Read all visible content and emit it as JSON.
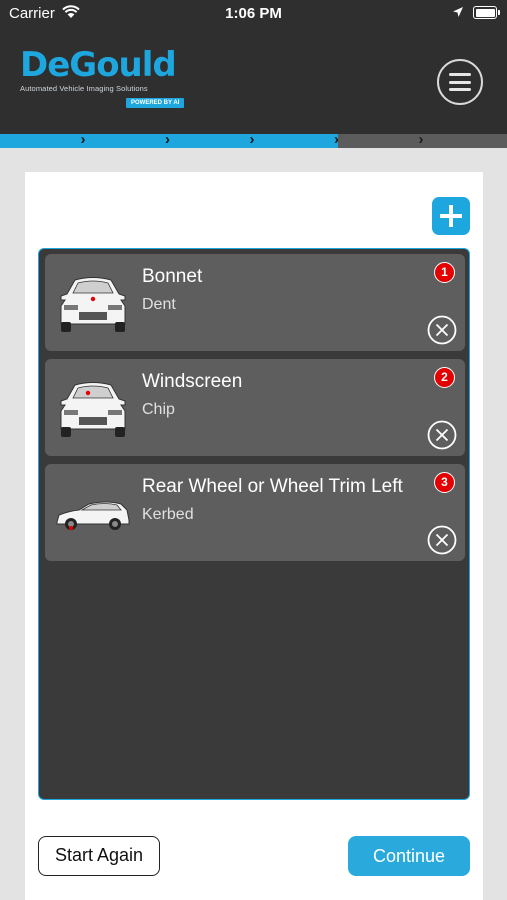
{
  "status_bar": {
    "carrier": "Carrier",
    "time": "1:06 PM"
  },
  "header": {
    "brand": "DeGould",
    "tagline": "Automated Vehicle Imaging Solutions",
    "badge": "POWERED BY AI",
    "menu_icon": "hamburger-icon"
  },
  "progress": {
    "steps_total": 6,
    "steps_completed": 4
  },
  "actions": {
    "add_icon": "plus-icon",
    "start_again_label": "Start Again",
    "continue_label": "Continue"
  },
  "damages": [
    {
      "number": "1",
      "area": "Bonnet",
      "damage": "Dent",
      "view": "front-car-icon"
    },
    {
      "number": "2",
      "area": "Windscreen",
      "damage": "Chip",
      "view": "front-car-icon"
    },
    {
      "number": "3",
      "area": "Rear Wheel or Wheel Trim Left",
      "damage": "Kerbed",
      "view": "side-car-icon"
    }
  ],
  "colors": {
    "accent": "#1ea6df",
    "header_bg": "#2f2f2f",
    "list_bg": "#3a3a3a",
    "card_bg": "#5e5e5e",
    "badge_red": "#e40000"
  }
}
